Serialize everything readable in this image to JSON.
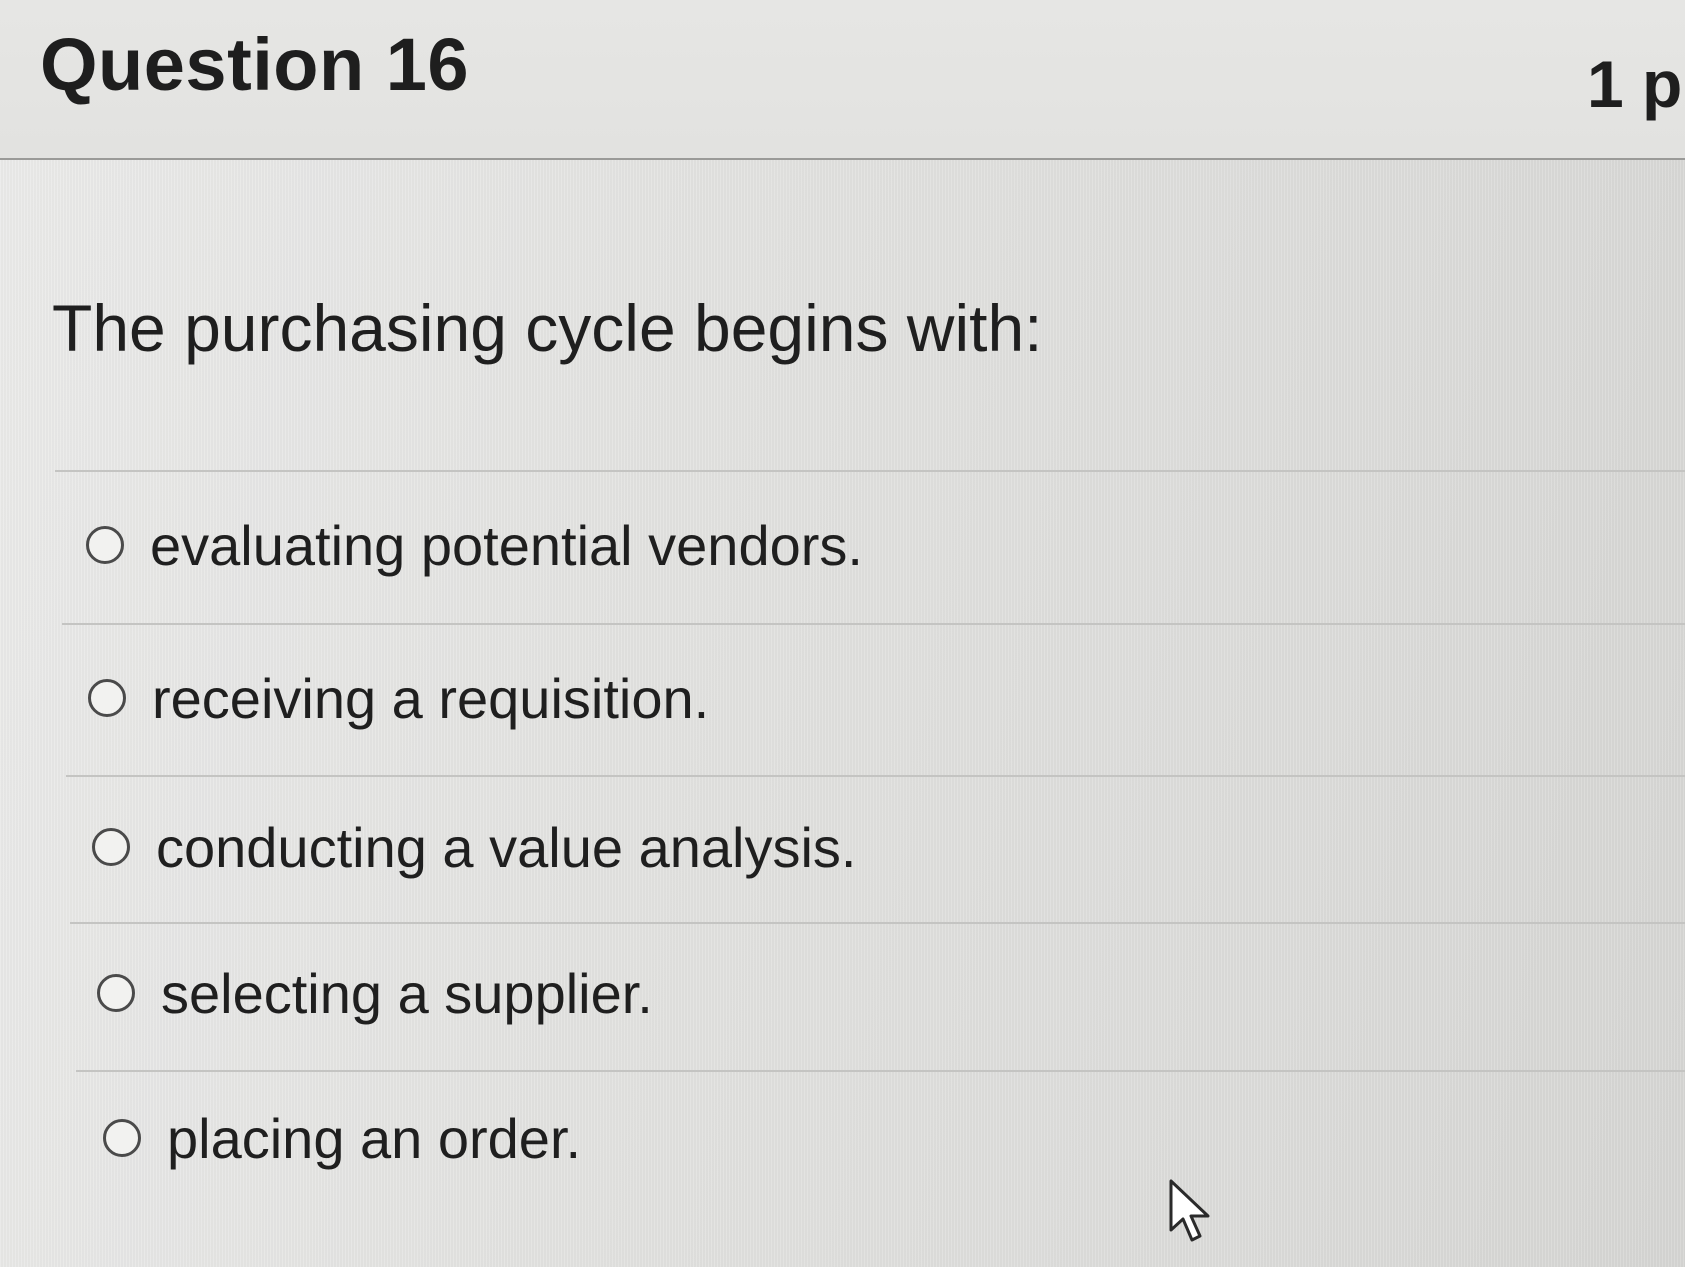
{
  "question": {
    "title": "Question 16",
    "points": "1 p",
    "text": "The purchasing cycle begins with:"
  },
  "answers": [
    {
      "label": "evaluating potential vendors."
    },
    {
      "label": "receiving a requisition."
    },
    {
      "label": "conducting a value analysis."
    },
    {
      "label": "selecting a supplier."
    },
    {
      "label": "placing an order."
    }
  ],
  "colors": {
    "text": "#1f1f1f",
    "background": "#e4e4e2",
    "divider": "#c4c4c2"
  },
  "icons": {
    "cursor": "mouse-pointer-icon",
    "radio": "radio-button-empty"
  }
}
